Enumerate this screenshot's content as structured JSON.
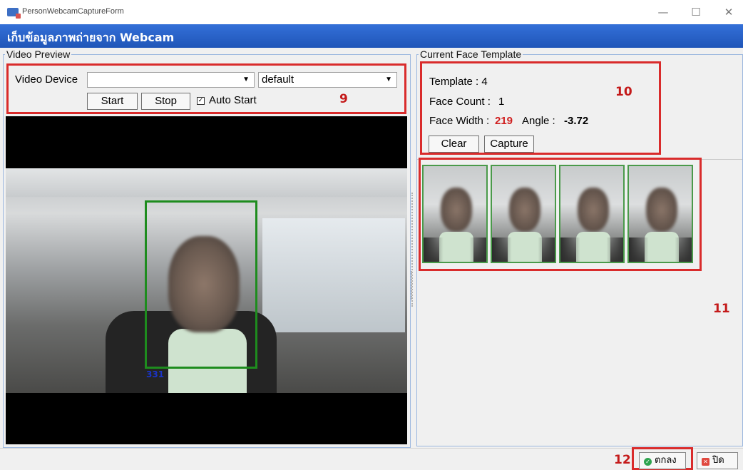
{
  "window": {
    "title": "PersonWebcamCaptureForm",
    "minimize_glyph": "—",
    "maximize_glyph": "☐",
    "close_glyph": "✕"
  },
  "header": {
    "title": "เก็บข้อมูลภาพถ่ายจาก Webcam"
  },
  "video_preview": {
    "group_label": "Video Preview",
    "device_label": "Video Device",
    "device_value": "",
    "resolution_value": "default",
    "start_label": "Start",
    "stop_label": "Stop",
    "auto_start_label": "Auto Start",
    "auto_start_checked": true,
    "face_id_label": "331"
  },
  "current_face_template": {
    "group_label": "Current Face Template",
    "template_text": "Template : 4",
    "face_count_label": "Face Count :",
    "face_count_value": "1",
    "face_width_label": "Face Width :",
    "face_width_value": "219",
    "angle_label": "Angle :",
    "angle_value": "-3.72",
    "clear_label": "Clear",
    "capture_label": "Capture",
    "thumbnail_count": 4
  },
  "annotations": {
    "a9": "9",
    "a10": "10",
    "a11": "11",
    "a12": "12"
  },
  "footer": {
    "ok_label": "ตกลง",
    "close_label": "ปิด"
  },
  "colors": {
    "header_blue": "#2461c8",
    "annotation_red": "#d92b2b",
    "face_box_green": "#1e8c1e",
    "face_width_red": "#d02020"
  }
}
